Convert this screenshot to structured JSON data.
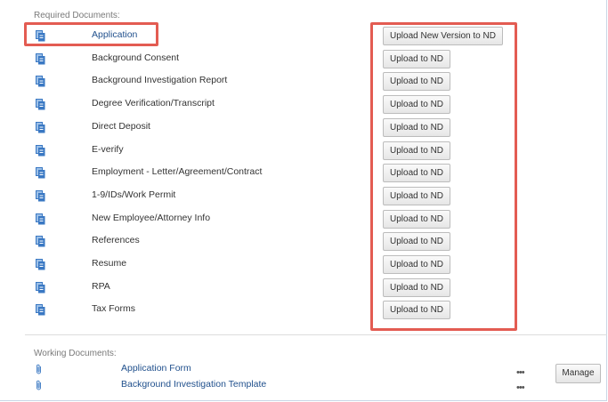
{
  "required_section": {
    "title": "Required Documents:",
    "documents": [
      {
        "label": "Application",
        "action": "Upload New Version to ND"
      },
      {
        "label": "Background Consent",
        "action": "Upload to ND"
      },
      {
        "label": "Background Investigation Report",
        "action": "Upload to ND"
      },
      {
        "label": "Degree Verification/Transcript",
        "action": "Upload to ND"
      },
      {
        "label": "Direct Deposit",
        "action": "Upload to ND"
      },
      {
        "label": "E-verify",
        "action": "Upload to ND"
      },
      {
        "label": "Employment - Letter/Agreement/Contract",
        "action": "Upload to ND"
      },
      {
        "label": "1-9/IDs/Work Permit",
        "action": "Upload to ND"
      },
      {
        "label": "New Employee/Attorney Info",
        "action": "Upload to ND"
      },
      {
        "label": "References",
        "action": "Upload to ND"
      },
      {
        "label": "Resume",
        "action": "Upload to ND"
      },
      {
        "label": "RPA",
        "action": "Upload to ND"
      },
      {
        "label": "Tax Forms",
        "action": "Upload to ND"
      }
    ]
  },
  "working_section": {
    "title": "Working Documents:",
    "documents": [
      {
        "label": "Application Form"
      },
      {
        "label": "Background Investigation Template"
      }
    ],
    "more_icon": "•••",
    "manage_label": "Manage"
  },
  "colors": {
    "highlight": "#e35c52",
    "link": "#1f4f8c",
    "doc_icon": "#3a78c3"
  },
  "icons": {
    "required_doc": "document-stack-icon",
    "working_doc": "paperclip-icon",
    "more": "more-dots-icon"
  }
}
